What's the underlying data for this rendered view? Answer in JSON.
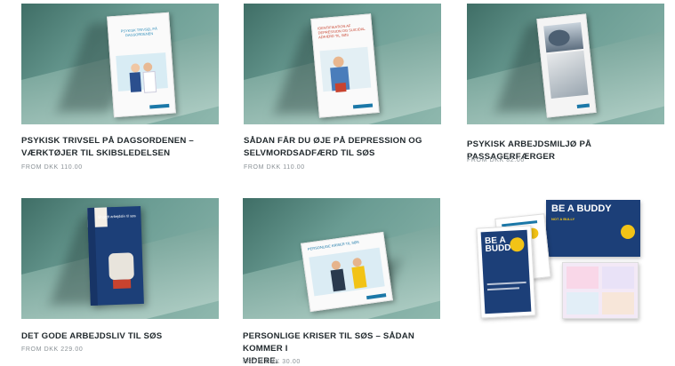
{
  "products": [
    {
      "title": "PSYKISK TRIVSEL PÅ DAGSORDENEN –\nVÆRKTØJER TIL SKIBSLEDELSEN",
      "price_prefix": "FROM ",
      "price": "DKK 110.00",
      "cover_text": "PSYKISK TRIVSEL PÅ DAGSORDENEN"
    },
    {
      "title": "SÅDAN FÅR DU ØJE PÅ DEPRESSION OG\nSELVMORDSADFÆRD TIL SØS",
      "price_prefix": "FROM ",
      "price": "DKK 110.00",
      "cover_text": "IDENTIFIKATION AF DEPRESSION OG SUICIDAL ADFÆRD TIL SØS"
    },
    {
      "title": "PSYKISK ARBEJDSMILJØ PÅ PASSAGERFÆRGER",
      "price_prefix": "FROM ",
      "price": "DKK 82.00"
    },
    {
      "title": "DET GODE ARBEJDSLIV TIL SØS",
      "price_prefix": "FROM ",
      "price": "DKK 229.00",
      "cover_text": "Et godt arbejdsliv til søs"
    },
    {
      "title": "PERSONLIGE KRISER TIL SØS – SÅDAN KOMMER I\nVIDERE.",
      "price_prefix": "FROM ",
      "price": "DKK 30.00",
      "cover_text": "PERSONLIGE KRISER TIL SØS"
    },
    {
      "cover_text_big": "BE A BUDDY",
      "cover_text_small": "NOT A BULLY"
    }
  ],
  "colors": {
    "teal_background": "#5f9088",
    "navy_cover": "#1c3f78",
    "brand_blue": "#1b78a8",
    "badge_yellow": "#f2c316"
  }
}
